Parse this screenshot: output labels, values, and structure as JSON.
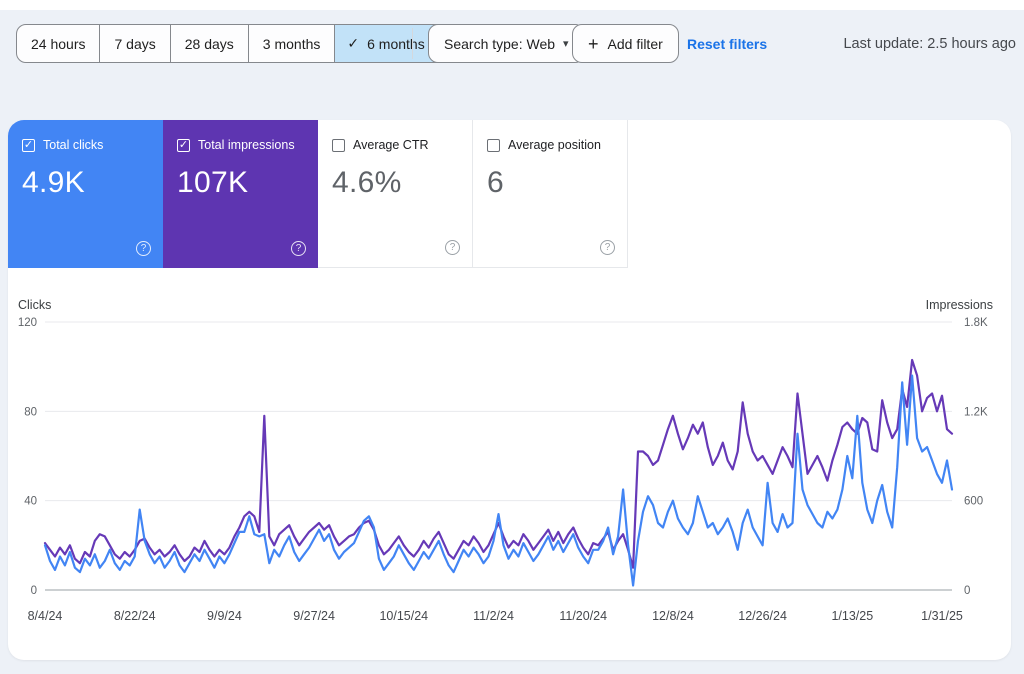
{
  "theme": {
    "page_background": "#edf1f7",
    "panel_background": "#ffffff",
    "link_color": "#1a73e8",
    "selected_range_background": "#c2e2f8",
    "clicks_color": "#4285f4",
    "impressions_color": "#6639b7"
  },
  "icons": {
    "check": "✓",
    "caret_down": "▾",
    "plus": "+",
    "help": "?"
  },
  "toolbar": {
    "date_ranges": [
      {
        "label": "24 hours",
        "selected": false
      },
      {
        "label": "7 days",
        "selected": false
      },
      {
        "label": "28 days",
        "selected": false
      },
      {
        "label": "3 months",
        "selected": false
      },
      {
        "label": "6 months",
        "selected": true
      }
    ],
    "search_type_label": "Search type: Web",
    "add_filter_label": "Add filter",
    "reset_filters_label": "Reset filters",
    "last_update": "Last update: 2.5 hours ago"
  },
  "metric_cards": [
    {
      "label": "Total clicks",
      "value": "4.9K",
      "checked": true,
      "bg": "#4285f4",
      "fg": "#ffffff"
    },
    {
      "label": "Total impressions",
      "value": "107K",
      "checked": true,
      "bg": "#5e35b1",
      "fg": "#ffffff"
    },
    {
      "label": "Average CTR",
      "value": "4.6%",
      "checked": false,
      "bg": "#ffffff",
      "fg": "#5f6368"
    },
    {
      "label": "Average position",
      "value": "6",
      "checked": false,
      "bg": "#ffffff",
      "fg": "#5f6368"
    }
  ],
  "chart_data": {
    "type": "line",
    "grid": true,
    "left_axis": {
      "label": "Clicks",
      "max": 120,
      "ticks": [
        0,
        40,
        80,
        120
      ],
      "tick_labels": [
        "0",
        "40",
        "80",
        "120"
      ]
    },
    "right_axis": {
      "label": "Impressions",
      "max": 1800,
      "ticks": [
        0,
        600,
        1200,
        1800
      ],
      "tick_labels": [
        "0",
        "600",
        "1.2K",
        "1.8K"
      ]
    },
    "x_tick_labels": [
      "8/4/24",
      "8/22/24",
      "9/9/24",
      "9/27/24",
      "10/15/24",
      "11/2/24",
      "11/20/24",
      "12/8/24",
      "12/26/24",
      "1/13/25",
      "1/31/25"
    ],
    "x_tick_interval_days": 18,
    "series": [
      {
        "name": "Clicks",
        "axis": "left",
        "color": "#4285f4",
        "values": [
          20,
          13,
          9,
          15,
          11,
          17,
          10,
          8,
          14,
          11,
          16,
          10,
          13,
          18,
          12,
          9,
          13,
          11,
          15,
          36,
          22,
          16,
          12,
          15,
          10,
          13,
          17,
          11,
          8,
          12,
          16,
          13,
          18,
          14,
          10,
          15,
          12,
          16,
          21,
          26,
          26,
          33,
          25,
          24,
          25,
          12,
          18,
          15,
          20,
          24,
          17,
          13,
          16,
          19,
          23,
          27,
          22,
          25,
          18,
          14,
          17,
          19,
          21,
          26,
          31,
          33,
          28,
          14,
          9,
          12,
          15,
          20,
          16,
          12,
          9,
          13,
          17,
          14,
          18,
          22,
          16,
          11,
          8,
          13,
          18,
          15,
          19,
          16,
          12,
          15,
          22,
          34,
          20,
          14,
          18,
          15,
          21,
          17,
          13,
          16,
          20,
          24,
          18,
          22,
          17,
          21,
          25,
          19,
          15,
          12,
          18,
          18,
          22,
          28,
          16,
          24,
          45,
          20,
          2,
          22,
          35,
          42,
          38,
          30,
          28,
          35,
          40,
          32,
          28,
          25,
          30,
          42,
          35,
          28,
          30,
          25,
          28,
          32,
          26,
          18,
          30,
          36,
          28,
          24,
          20,
          48,
          30,
          26,
          34,
          28,
          30,
          70,
          45,
          38,
          34,
          30,
          28,
          35,
          32,
          36,
          45,
          60,
          50,
          78,
          48,
          36,
          30,
          40,
          47,
          35,
          28,
          55,
          93,
          65,
          96,
          68,
          62,
          64,
          58,
          52,
          48,
          58,
          45
        ]
      },
      {
        "name": "Impressions",
        "axis": "right",
        "color": "#6639b7",
        "values": [
          315,
          270,
          225,
          285,
          240,
          300,
          210,
          180,
          255,
          225,
          330,
          375,
          360,
          300,
          240,
          210,
          255,
          225,
          270,
          330,
          345,
          285,
          240,
          270,
          225,
          255,
          300,
          240,
          195,
          225,
          285,
          255,
          330,
          270,
          225,
          270,
          240,
          285,
          360,
          420,
          495,
          525,
          495,
          390,
          1170,
          360,
          300,
          375,
          405,
          435,
          360,
          300,
          345,
          390,
          420,
          450,
          405,
          435,
          360,
          300,
          330,
          360,
          375,
          420,
          450,
          465,
          405,
          300,
          240,
          270,
          315,
          360,
          300,
          255,
          225,
          270,
          330,
          285,
          345,
          390,
          315,
          240,
          210,
          270,
          330,
          300,
          360,
          315,
          255,
          300,
          375,
          450,
          360,
          285,
          330,
          300,
          375,
          330,
          270,
          315,
          360,
          405,
          330,
          390,
          315,
          375,
          420,
          345,
          285,
          240,
          315,
          300,
          345,
          390,
          270,
          330,
          375,
          270,
          150,
          930,
          930,
          900,
          840,
          870,
          975,
          1080,
          1170,
          1050,
          945,
          1020,
          1110,
          1050,
          1125,
          960,
          840,
          900,
          990,
          870,
          810,
          930,
          1260,
          1050,
          930,
          870,
          900,
          840,
          780,
          870,
          960,
          900,
          825,
          1320,
          1050,
          780,
          840,
          900,
          825,
          735,
          870,
          975,
          1095,
          1125,
          1080,
          1050,
          1155,
          1125,
          945,
          930,
          1275,
          1125,
          1020,
          1080,
          1350,
          1230,
          1545,
          1440,
          1200,
          1290,
          1320,
          1200,
          1305,
          1080,
          1050
        ]
      }
    ]
  }
}
